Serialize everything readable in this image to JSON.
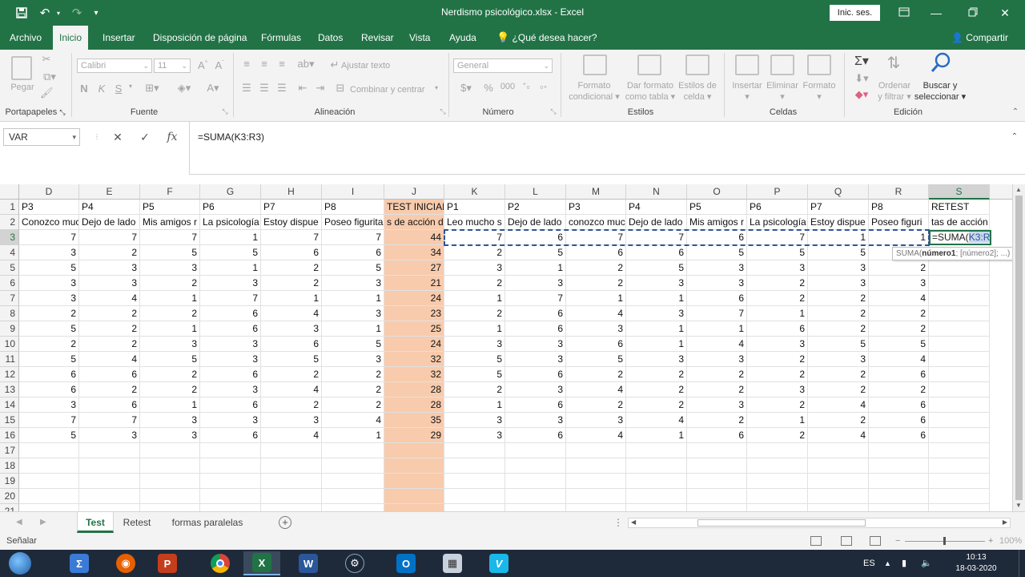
{
  "window": {
    "title": "Nerdismo psicológico.xlsx  -  Excel",
    "signin_label": "Inic. ses.",
    "controls": [
      "ribbon-display-options",
      "minimize",
      "restore",
      "close"
    ]
  },
  "menu": {
    "tabs": [
      "Archivo",
      "Inicio",
      "Insertar",
      "Disposición de página",
      "Fórmulas",
      "Datos",
      "Revisar",
      "Vista",
      "Ayuda"
    ],
    "active_tab": "Inicio",
    "tellme": "¿Qué desea hacer?",
    "share": "Compartir"
  },
  "ribbon": {
    "clipboard": {
      "paste": "Pegar",
      "label": "Portapapeles"
    },
    "font": {
      "name": "Calibri",
      "size": "11",
      "bold": "N",
      "italic": "K",
      "underline": "S",
      "label": "Fuente"
    },
    "alignment": {
      "wrap": "Ajustar texto",
      "merge": "Combinar y centrar",
      "label": "Alineación"
    },
    "number": {
      "format": "General",
      "label": "Número"
    },
    "styles": {
      "conditional": [
        "Formato",
        "condicional"
      ],
      "as_table": [
        "Dar formato",
        "como tabla"
      ],
      "cell_styles": [
        "Estilos de",
        "celda"
      ],
      "label": "Estilos"
    },
    "cells": {
      "insert": "Insertar",
      "delete": "Eliminar",
      "format": "Formato",
      "label": "Celdas"
    },
    "editing": {
      "sort": [
        "Ordenar",
        "y filtrar"
      ],
      "find": [
        "Buscar y",
        "seleccionar"
      ],
      "label": "Edición"
    }
  },
  "formula_bar": {
    "name_box": "VAR",
    "formula": "=SUMA(K3:R3)"
  },
  "sheet": {
    "columns": [
      "D",
      "E",
      "F",
      "G",
      "H",
      "I",
      "J",
      "K",
      "L",
      "M",
      "N",
      "O",
      "P",
      "Q",
      "R",
      "S"
    ],
    "row_numbers": [
      "1",
      "2",
      "3",
      "4",
      "5",
      "6",
      "7",
      "8",
      "9",
      "10",
      "11",
      "12",
      "13",
      "14",
      "15",
      "16",
      "17",
      "18",
      "19",
      "20",
      "21"
    ],
    "header_row": [
      "P3",
      "P4",
      "P5",
      "P6",
      "P7",
      "P8",
      "TEST INICIAL",
      "P1",
      "P2",
      "P3",
      "P4",
      "P5",
      "P6",
      "P7",
      "P8",
      "RETEST"
    ],
    "question_row": [
      "Conozco mucho",
      "Dejo de lado",
      "Mis amigos r",
      "La psicología",
      "Estoy dispue",
      "Poseo figurita",
      "s de acción d",
      "Leo mucho s",
      "Dejo de lado",
      "conozco muc",
      "Dejo de lado",
      "Mis amigos r",
      "La psicología",
      "Estoy dispue",
      "Poseo figuri",
      "tas de acción de gr"
    ],
    "data_rows": [
      [
        "7",
        "7",
        "7",
        "1",
        "7",
        "7",
        "44",
        "7",
        "6",
        "7",
        "7",
        "6",
        "7",
        "1",
        "1"
      ],
      [
        "3",
        "2",
        "5",
        "5",
        "6",
        "6",
        "34",
        "2",
        "5",
        "6",
        "6",
        "5",
        "5",
        "5",
        ""
      ],
      [
        "5",
        "3",
        "3",
        "1",
        "2",
        "5",
        "27",
        "3",
        "1",
        "2",
        "5",
        "3",
        "3",
        "3",
        "2"
      ],
      [
        "3",
        "3",
        "2",
        "3",
        "2",
        "3",
        "21",
        "2",
        "3",
        "2",
        "3",
        "3",
        "2",
        "3",
        "3"
      ],
      [
        "3",
        "4",
        "1",
        "7",
        "1",
        "1",
        "24",
        "1",
        "7",
        "1",
        "1",
        "6",
        "2",
        "2",
        "4"
      ],
      [
        "2",
        "2",
        "2",
        "6",
        "4",
        "3",
        "23",
        "2",
        "6",
        "4",
        "3",
        "7",
        "1",
        "2",
        "2"
      ],
      [
        "5",
        "2",
        "1",
        "6",
        "3",
        "1",
        "25",
        "1",
        "6",
        "3",
        "1",
        "1",
        "6",
        "2",
        "2"
      ],
      [
        "2",
        "2",
        "3",
        "3",
        "6",
        "5",
        "24",
        "3",
        "3",
        "6",
        "1",
        "4",
        "3",
        "5",
        "5"
      ],
      [
        "5",
        "4",
        "5",
        "3",
        "5",
        "3",
        "32",
        "5",
        "3",
        "5",
        "3",
        "3",
        "2",
        "3",
        "4"
      ],
      [
        "6",
        "6",
        "2",
        "6",
        "2",
        "2",
        "32",
        "5",
        "6",
        "2",
        "2",
        "2",
        "2",
        "2",
        "6"
      ],
      [
        "6",
        "2",
        "2",
        "3",
        "4",
        "2",
        "28",
        "2",
        "3",
        "4",
        "2",
        "2",
        "3",
        "2",
        "2"
      ],
      [
        "3",
        "6",
        "1",
        "6",
        "2",
        "2",
        "28",
        "1",
        "6",
        "2",
        "2",
        "3",
        "2",
        "4",
        "6"
      ],
      [
        "7",
        "7",
        "3",
        "3",
        "3",
        "4",
        "35",
        "3",
        "3",
        "3",
        "4",
        "2",
        "1",
        "2",
        "6"
      ],
      [
        "5",
        "3",
        "3",
        "6",
        "4",
        "1",
        "29",
        "3",
        "6",
        "4",
        "1",
        "6",
        "2",
        "4",
        "6"
      ]
    ],
    "edit_cell": {
      "prefix": "=SUMA(",
      "ref": "K3:R3",
      "suffix": ")"
    },
    "tooltip": {
      "fn": "SUMA(",
      "arg1": "número1",
      "rest": "; [número2]; ...)"
    },
    "highlight_color": "#f8cbad",
    "accent_color": "#217346"
  },
  "sheet_tabs": [
    "Test",
    "Retest",
    "formas paralelas"
  ],
  "active_sheet": "Test",
  "status": {
    "mode": "Señalar",
    "zoom": "100%"
  },
  "taskbar": {
    "lang": "ES",
    "time": "10:13",
    "date": "18-03-2020",
    "apps": [
      "start",
      "sigma",
      "firefox",
      "powerpoint",
      "chrome",
      "excel",
      "word",
      "steam",
      "outlook",
      "calculator",
      "vimeo"
    ]
  }
}
